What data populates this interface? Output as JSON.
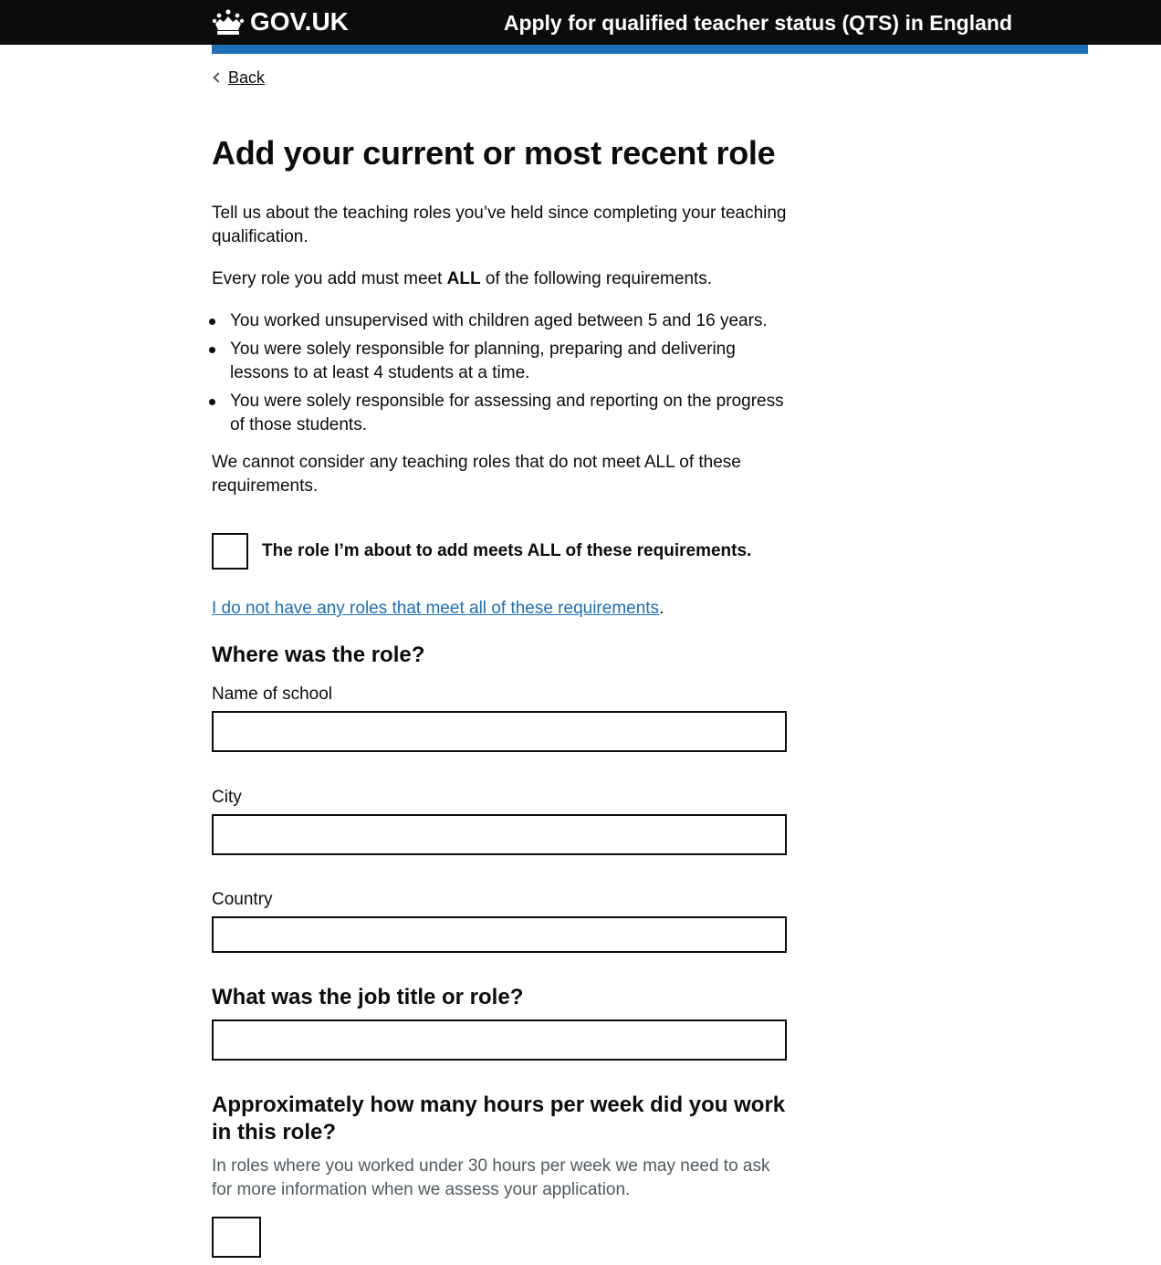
{
  "header": {
    "logo_text": "GOV.UK",
    "service_name": "Apply for qualified teacher status (QTS) in England",
    "accent_color": "#1d70b8",
    "logo_icon": "crown-icon"
  },
  "nav": {
    "back_label": "Back",
    "back_icon": "chevron-left-icon"
  },
  "main": {
    "title": "Add your current or most recent role",
    "intro": "Tell us about the teaching roles you’ve held since completing your teaching qualification.",
    "req_intro_before": "Every role you add must meet ",
    "req_intro_bold": "ALL",
    "req_intro_after": " of the following requirements.",
    "requirements": [
      "You worked unsupervised with children aged between 5 and 16 years.",
      "You were solely responsible for planning, preparing and delivering lessons to at least 4 students at a time.",
      "You were solely responsible for assessing and reporting on the progress of those students."
    ],
    "warning": "We cannot consider any teaching roles that do not meet ALL of these requirements.",
    "checkbox_label": "The role I’m about to add meets ALL of these requirements.",
    "no_roles_link": "I do not have any roles that meet all of these requirements",
    "no_roles_suffix": "."
  },
  "where": {
    "heading": "Where was the role?",
    "school_label": "Name of school",
    "school_value": "",
    "city_label": "City",
    "city_value": "",
    "country_label": "Country",
    "country_value": ""
  },
  "job": {
    "heading": "What was the job title or role?",
    "value": ""
  },
  "hours": {
    "heading": "Approximately how many hours per week did you work in this role?",
    "hint": "In roles where you worked under 30 hours per week we may need to ask for more information when we assess your application.",
    "value": ""
  }
}
